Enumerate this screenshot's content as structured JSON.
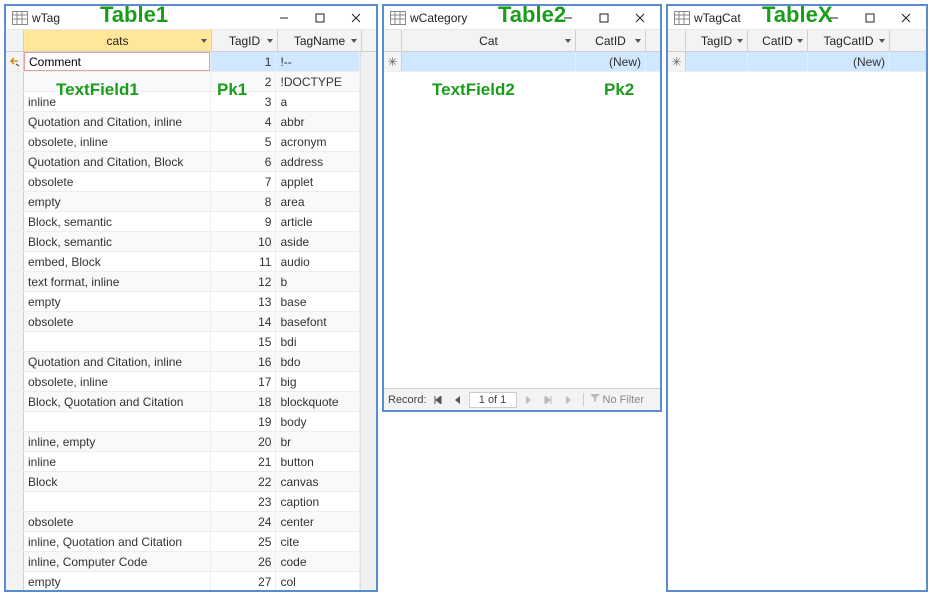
{
  "annotations": {
    "table1": "Table1",
    "table2": "Table2",
    "tablex": "TableX",
    "textfield1": "TextField1",
    "textfield2": "TextField2",
    "pk1": "Pk1",
    "pk2": "Pk2"
  },
  "win1": {
    "title": "wTag",
    "cols": {
      "cats": "cats",
      "tagid": "TagID",
      "tagname": "TagName"
    },
    "editvalue": "Comment",
    "rows": [
      {
        "cats": "",
        "id": 1,
        "name": "!--"
      },
      {
        "cats": "",
        "id": 2,
        "name": "!DOCTYPE"
      },
      {
        "cats": "inline",
        "id": 3,
        "name": "a"
      },
      {
        "cats": "Quotation and Citation, inline",
        "id": 4,
        "name": "abbr"
      },
      {
        "cats": "obsolete, inline",
        "id": 5,
        "name": "acronym"
      },
      {
        "cats": "Quotation and Citation, Block",
        "id": 6,
        "name": "address"
      },
      {
        "cats": "obsolete",
        "id": 7,
        "name": "applet"
      },
      {
        "cats": "empty",
        "id": 8,
        "name": "area"
      },
      {
        "cats": "Block, semantic",
        "id": 9,
        "name": "article"
      },
      {
        "cats": "Block, semantic",
        "id": 10,
        "name": "aside"
      },
      {
        "cats": "embed, Block",
        "id": 11,
        "name": "audio"
      },
      {
        "cats": "text format, inline",
        "id": 12,
        "name": "b"
      },
      {
        "cats": "empty",
        "id": 13,
        "name": "base"
      },
      {
        "cats": "obsolete",
        "id": 14,
        "name": "basefont"
      },
      {
        "cats": "",
        "id": 15,
        "name": "bdi"
      },
      {
        "cats": "Quotation and Citation, inline",
        "id": 16,
        "name": "bdo"
      },
      {
        "cats": "obsolete, inline",
        "id": 17,
        "name": "big"
      },
      {
        "cats": "Block, Quotation and Citation",
        "id": 18,
        "name": "blockquote"
      },
      {
        "cats": "",
        "id": 19,
        "name": "body"
      },
      {
        "cats": "inline, empty",
        "id": 20,
        "name": "br"
      },
      {
        "cats": "inline",
        "id": 21,
        "name": "button"
      },
      {
        "cats": "Block",
        "id": 22,
        "name": "canvas"
      },
      {
        "cats": "",
        "id": 23,
        "name": "caption"
      },
      {
        "cats": "obsolete",
        "id": 24,
        "name": "center"
      },
      {
        "cats": "inline, Quotation and Citation",
        "id": 25,
        "name": "cite"
      },
      {
        "cats": "inline, Computer Code",
        "id": 26,
        "name": "code"
      },
      {
        "cats": "empty",
        "id": 27,
        "name": "col"
      }
    ]
  },
  "win2": {
    "title": "wCategory",
    "cols": {
      "cat": "Cat",
      "catid": "CatID"
    },
    "newlabel": "(New)",
    "nav": {
      "record": "Record:",
      "pos": "1 of 1",
      "nofilter": "No Filter"
    }
  },
  "win3": {
    "title": "wTagCat",
    "cols": {
      "tagid": "TagID",
      "catid": "CatID",
      "tagcatid": "TagCatID"
    },
    "newlabel": "(New)"
  }
}
